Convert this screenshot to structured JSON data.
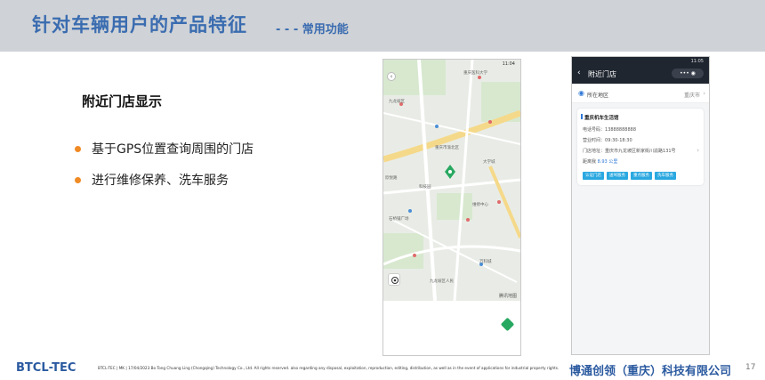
{
  "header": {
    "title": "针对车辆用户的产品特征",
    "subtitle": "- - - 常用功能"
  },
  "section": {
    "title": "附近门店显示",
    "bullets": [
      "基于GPS位置查询周围的门店",
      "进行维修保养、洗车服务"
    ]
  },
  "map_phone": {
    "time": "11:04",
    "logo": "腾讯地图",
    "labels": [
      "重庆医科大学",
      "九龙坡区",
      "大学城",
      "石桥铺广场",
      "重庆市渝北区",
      "九龙坡区人民",
      "万科城",
      "维修中心",
      "欣悦路",
      "科技园"
    ]
  },
  "store_phone": {
    "status_time": "11:05",
    "title": "附近门店",
    "capsule": "•••  ◉",
    "location_label": "所在地区",
    "city": "重庆市",
    "store_name": "重庆机车生活馆",
    "phone_label": "电话号码：",
    "phone": "13888888888",
    "hours_label": "营业时间：",
    "hours": "09:30-18:30",
    "address_label": "门店地址：",
    "address": "重庆市九龙坡区新家街川渝路131号",
    "distance_prefix": "距离我",
    "distance": "8.93",
    "distance_unit": "公里",
    "buttons": [
      "认证门店",
      "送驾服务",
      "重点服务",
      "洗车服务"
    ]
  },
  "footer": {
    "brand": "BTCL-TEC",
    "note": "BTCL-TEC | MK | 17/04/2023  Bo Tong Chuang Ling (Chongqing) Technology Co., Ltd.  All rights reserved. also regarding any disposal, exploitation, reproduction, editing, distribution, as well as in the event of applications for industrial property rights.",
    "company": "博通创领（重庆）科技有限公司",
    "page": "17"
  },
  "colors": {
    "title_blue": "#3a6cb0",
    "bullet_orange": "#f08a24",
    "button_blue": "#2aa8e0",
    "header_bg": "#cfd2d6"
  }
}
